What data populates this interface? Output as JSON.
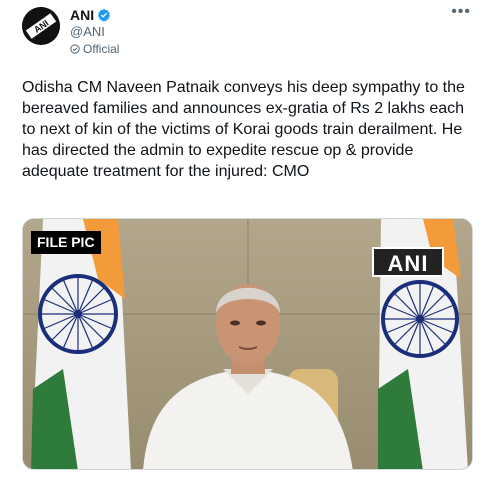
{
  "tweet": {
    "author_name": "ANI",
    "handle": "@ANI",
    "official_label": "Official",
    "more_label": "•••",
    "text": "Odisha CM Naveen Patnaik conveys his deep sympathy to the bereaved families and announces ex-gratia of Rs 2 lakhs each to next of kin of the victims of Korai goods train derailment. He has directed the admin to expedite rescue op & provide adequate treatment for the injured: CMO",
    "media": {
      "overlay_label": "FILE PIC",
      "logo_text": "ANI"
    }
  },
  "icons": {
    "avatar": "ani-logo-avatar",
    "verified": "verified-badge-icon",
    "official": "official-badge-icon",
    "more": "more-options-icon"
  },
  "colors": {
    "verified_blue": "#1d9bf0",
    "secondary_text": "#536471"
  }
}
